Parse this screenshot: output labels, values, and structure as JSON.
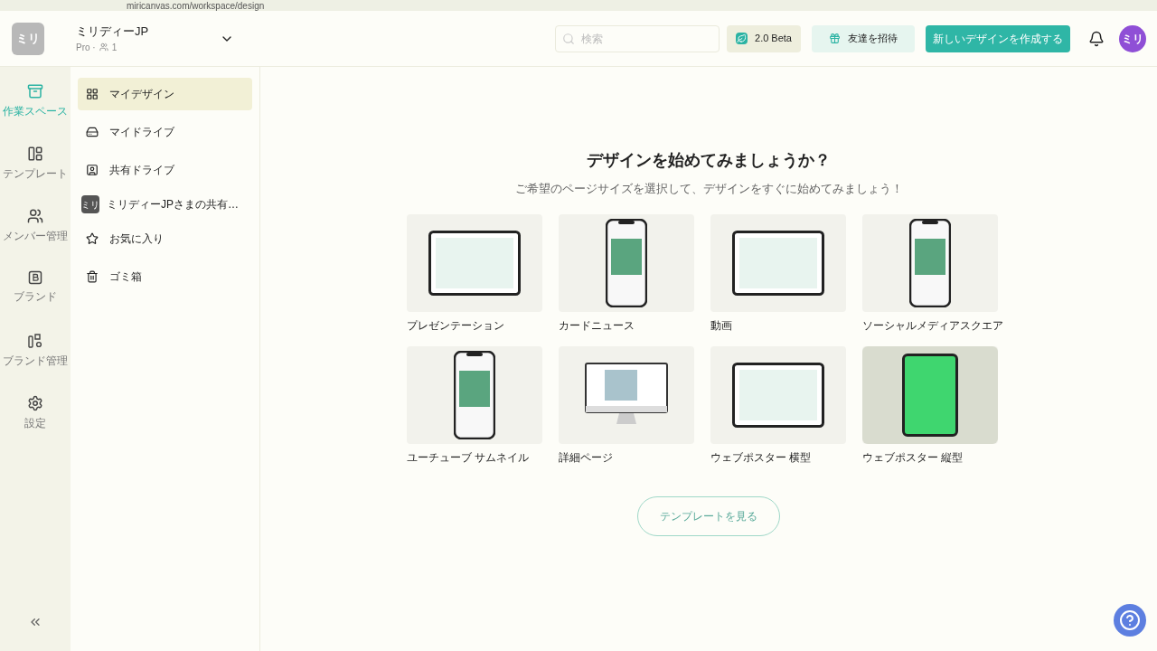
{
  "browser": {
    "url": "miricanvas.com/workspace/design"
  },
  "header": {
    "logo": "ミリ",
    "workspace_name": "ミリディーJP",
    "plan": "Pro ·",
    "member_count": "1",
    "search": {
      "placeholder": "検索"
    },
    "beta_button": "2.0 Beta",
    "invite_button": "友達を招待",
    "create_button": "新しいデザインを作成する",
    "avatar": "ミリ"
  },
  "rail": [
    {
      "label": "作業スペース",
      "selected": true
    },
    {
      "label": "テンプレート",
      "selected": false
    },
    {
      "label": "メンバー管理",
      "selected": false
    },
    {
      "label": "ブランド",
      "selected": false
    },
    {
      "label": "ブランド管理",
      "selected": false
    },
    {
      "label": "設定",
      "selected": false
    }
  ],
  "sidebar": {
    "items": [
      {
        "label": "マイデザイン",
        "selected": true
      },
      {
        "label": "マイドライブ",
        "selected": false
      },
      {
        "label": "共有ドライブ",
        "selected": false,
        "children": [
          {
            "label": "ミリディーJPさまの共有…",
            "badge": "ミリ",
            "selected": false
          }
        ]
      },
      {
        "label": "お気に入り",
        "selected": false
      },
      {
        "label": "ゴミ箱",
        "selected": false
      }
    ]
  },
  "main": {
    "title": "デザインを始めてみましょうか？",
    "subtitle": "ご希望のページサイズを選択して、デザインをすぐに始めてみましょう！",
    "templates": [
      {
        "label": "プレゼンテーション",
        "kind": "tablet"
      },
      {
        "label": "カードニュース",
        "kind": "phone"
      },
      {
        "label": "動画",
        "kind": "tablet"
      },
      {
        "label": "ソーシャルメディアスクエア",
        "kind": "phone"
      },
      {
        "label": "ユーチューブ サムネイル",
        "kind": "phone"
      },
      {
        "label": "詳細ページ",
        "kind": "monitor"
      },
      {
        "label": "ウェブポスター 横型",
        "kind": "tablet"
      },
      {
        "label": "ウェブポスター 縦型",
        "kind": "photo"
      }
    ],
    "more_button": "テンプレートを見る"
  }
}
